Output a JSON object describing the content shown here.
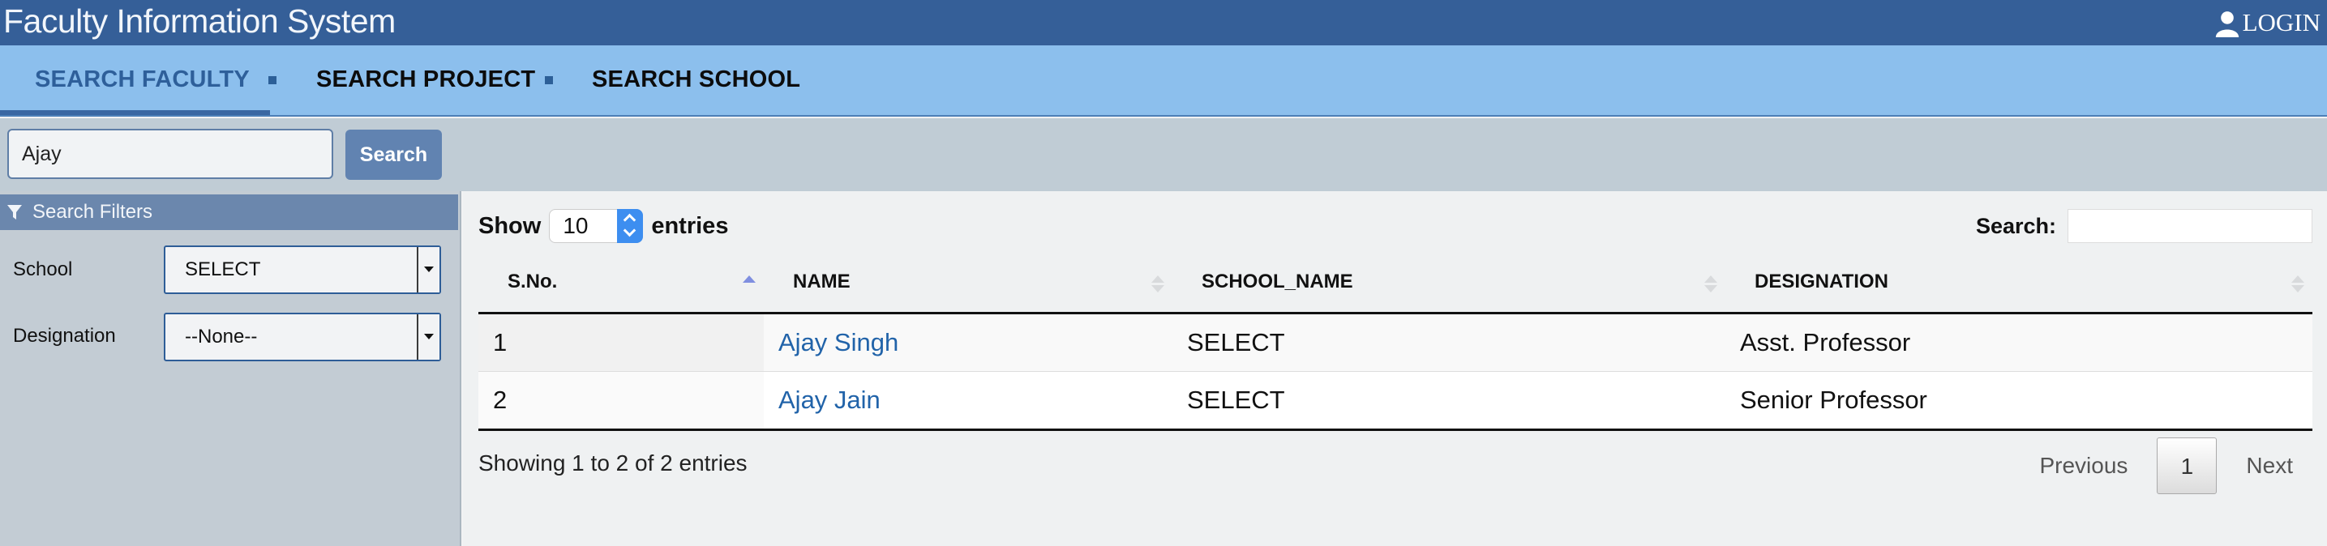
{
  "app": {
    "title": "Faculty Information System",
    "login_label": "LOGIN"
  },
  "nav": {
    "items": [
      {
        "label": "SEARCH FACULTY",
        "active": true
      },
      {
        "label": "SEARCH PROJECT",
        "active": false
      },
      {
        "label": "SEARCH SCHOOL",
        "active": false
      }
    ]
  },
  "search": {
    "query": "Ajay",
    "button_label": "Search"
  },
  "filters": {
    "header": "Search Filters",
    "school": {
      "label": "School",
      "value": "SELECT"
    },
    "designation": {
      "label": "Designation",
      "value": "--None--"
    }
  },
  "table": {
    "show_label": "Show",
    "page_length": "10",
    "entries_label": "entries",
    "search_label": "Search:",
    "columns": [
      "S.No.",
      "NAME",
      "SCHOOL_NAME",
      "DESIGNATION"
    ],
    "rows": [
      {
        "sno": "1",
        "name": "Ajay Singh",
        "school": "SELECT",
        "designation": "Asst. Professor"
      },
      {
        "sno": "2",
        "name": "Ajay Jain",
        "school": "SELECT",
        "designation": "Senior Professor"
      }
    ],
    "info": "Showing 1 to 2 of 2 entries",
    "pagination": {
      "previous": "Previous",
      "current": "1",
      "next": "Next"
    }
  },
  "colors": {
    "topbar": "#355f98",
    "navbar": "#8cbfed",
    "accent": "#2e5f9a",
    "link": "#2163a9"
  }
}
